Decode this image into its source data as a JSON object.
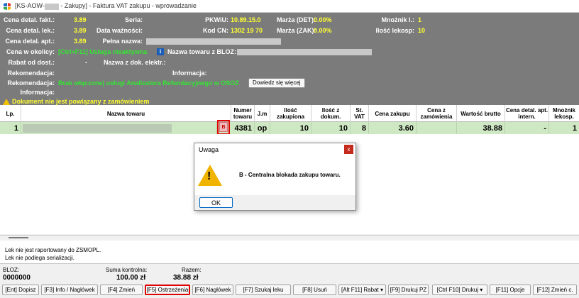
{
  "titlebar": {
    "title_prefix": "[KS-AOW-",
    "title_suffix": " - Zakupy] - Faktura VAT zakupu - wprowadzanie"
  },
  "info": {
    "cena_detal_fakt_label": "Cena detal. fakt.:",
    "cena_detal_fakt_value": "3.89",
    "cena_detal_lek_label": "Cena detal. lek.:",
    "cena_detal_lek_value": "3.89",
    "cena_detal_apt_label": "Cena detal. apt.:",
    "cena_detal_apt_value": "3.89",
    "seria_label": "Seria:",
    "data_waznosci_label": "Data ważności:",
    "pelna_nazwa_label": "Pełna nazwa:",
    "pkwiu_label": "PKWiU:",
    "pkwiu_value": "10.89.15.0",
    "kod_cn_label": "Kod CN:",
    "kod_cn_value": "1302 19 70",
    "marza_det_label": "Marża (DET):",
    "marza_det_value": "0.00%",
    "marza_zak_label": "Marża (ZAK):",
    "marza_zak_value": "0.00%",
    "mnoznik_label": "Mnożnik l.:",
    "mnoznik_value": "1",
    "ilosc_lekosp_label": "Ilość lekosp:",
    "ilosc_lekosp_value": "10",
    "cena_w_okolicy_label": "Cena w okolicy:",
    "cena_w_okolicy_value": "[Ctrl+F11] Usługa nieaktywna",
    "nazwa_bloz_label": "Nazwa towaru z BLOZ:",
    "rabat_label": "Rabat od dost.:",
    "rabat_value": "-",
    "nazwa_dok_label": "Nazwa z dok. elektr.:",
    "rekomendacja_label": "Rekomendacja:",
    "informacja_label": "Informacja:",
    "rekomendacja2_label": "Rekomendacja:",
    "rekomendacja2_value": "Brak włączonej usługi Analizatora Refundacyjnego w OSOZ",
    "dowiedz_button": "Dowiedz się więcej",
    "informacja2_label": "Informacja:",
    "warning_text": "Dokument nie jest powiązany z zamówieniem"
  },
  "grid": {
    "headers": {
      "lp": "Lp.",
      "nazwa": "Nazwa towaru",
      "numer": "Numer towaru",
      "jm": "J.m",
      "ilosc_zak": "Ilość zakupiona",
      "ilosc_dok": "Ilość z dokum.",
      "st_vat": "St. VAT",
      "cena_zakupu": "Cena zakupu",
      "cena_zam": "Cena z zamówienia",
      "wartosc": "Wartość brutto",
      "cena_detal_apt": "Cena detal. apt. intern.",
      "mnoznik": "Mnożnik lekosp."
    },
    "row": {
      "lp": "1",
      "marker": "B",
      "numer": "4381",
      "jm": "op",
      "ilosc_zak": "10",
      "ilosc_dok": "10",
      "st_vat": "8",
      "cena_zakupu": "3.60",
      "cena_zam": "",
      "wartosc": "38.88",
      "cena_detal_apt": "-",
      "mnoznik": "1"
    }
  },
  "dialog": {
    "title": "Uwaga",
    "close": "x",
    "message": "B - Centralna blokada zakupu towaru.",
    "ok": "OK"
  },
  "notes": {
    "line1": "Lek nie jest raportowany do ZSMOPL.",
    "line2": "Lek nie podlega serializacji."
  },
  "status": {
    "bloz_label": "BLOZ:",
    "bloz_value": "0000000",
    "suma_label": "Suma kontrolna:",
    "suma_value": "100.00 zł",
    "razem_label": "Razem:",
    "razem_value": "38.88 zł"
  },
  "fkeys": {
    "ent": "[Ent] Dopisz",
    "f3": "[F3] Info / Nagłówek",
    "f4": "[F4] Zmień",
    "f5": "[F5] Ostrzeżenia",
    "f6": "[F6] Nagłówek",
    "f7": "[F7] Szukaj leku",
    "f8": "[F8] Usuń",
    "altf11": "[Alt F11] Rabat ▾",
    "f9": "[F9] Drukuj PZ",
    "ctrlf10": "[Ctrl F10] Drukuj ▾",
    "f11": "[F11] Opcje",
    "f12": "[F12] Zmień c."
  },
  "colors": {
    "info_bg": "#7b7b7b",
    "value_yellow": "#ffff33",
    "value_green": "#33e633",
    "row_selected": "#cfe8c4",
    "highlight_red": "#e00000"
  }
}
